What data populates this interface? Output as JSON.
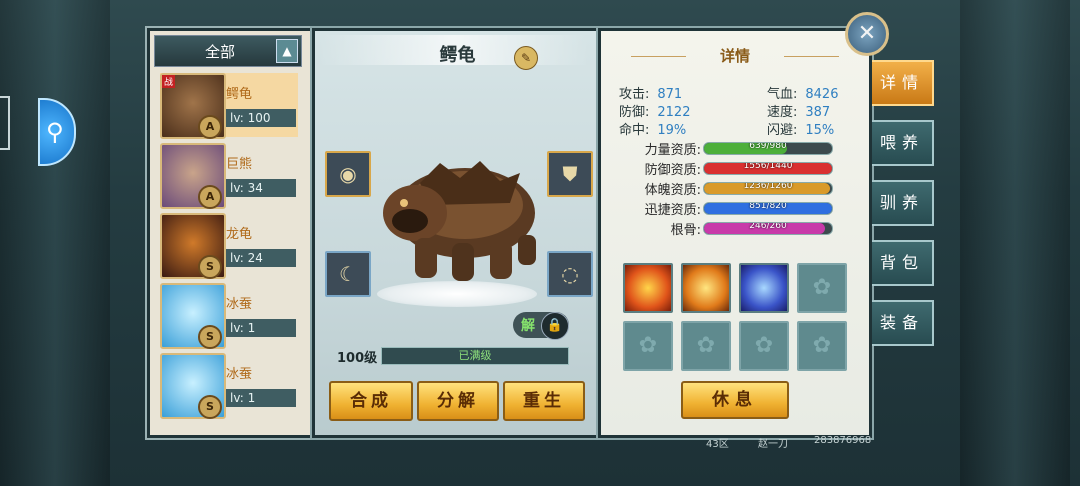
{
  "list": {
    "filter_label": "全部",
    "pets": [
      {
        "name": "鳄龟",
        "level": "lv: 100",
        "grade": "A",
        "color": "#6b4428",
        "selected": true,
        "badge": "战"
      },
      {
        "name": "巨熊",
        "level": "lv: 34",
        "grade": "A",
        "color": "#8a6a5a",
        "selected": false
      },
      {
        "name": "龙龟",
        "level": "lv: 24",
        "grade": "S",
        "color": "#7a3a1a",
        "selected": false
      },
      {
        "name": "冰蚕",
        "level": "lv: 1",
        "grade": "S",
        "color": "#6cc6f0",
        "selected": false
      },
      {
        "name": "冰蚕",
        "level": "lv: 1",
        "grade": "S",
        "color": "#6cc6f0",
        "selected": false
      }
    ]
  },
  "detail": {
    "pet_name": "鳄龟",
    "unlock_label": "解",
    "level_label": "100级",
    "exp_label": "已满级",
    "buttons": {
      "compose": "合成",
      "decompose": "分解",
      "rebirth": "重生"
    }
  },
  "info": {
    "title": "详情",
    "stats": {
      "attack_label": "攻击:",
      "attack": "871",
      "hp_label": "气血:",
      "hp": "8426",
      "defense_label": "防御:",
      "defense": "2122",
      "speed_label": "速度:",
      "speed": "387",
      "hit_label": "命中:",
      "hit": "19%",
      "dodge_label": "闪避:",
      "dodge": "15%"
    },
    "aptitudes": [
      {
        "label": "力量资质:",
        "value": "639/980",
        "ratio": 0.652,
        "color": "#4caf3a"
      },
      {
        "label": "防御资质:",
        "value": "1556/1440",
        "ratio": 1.0,
        "color": "#d93030"
      },
      {
        "label": "体魄资质:",
        "value": "1236/1260",
        "ratio": 0.981,
        "color": "#d99a2a"
      },
      {
        "label": "迅捷资质:",
        "value": "851/820",
        "ratio": 1.0,
        "color": "#2f6fe0"
      },
      {
        "label": "根骨:",
        "value": "246/260",
        "ratio": 0.946,
        "color": "#c83aa9"
      }
    ],
    "skill_icons": [
      "fire-ring-icon",
      "shield-flame-icon",
      "blue-shield-icon"
    ],
    "rest_label": "休息"
  },
  "tabs": [
    "详情",
    "喂养",
    "驯养",
    "背包",
    "装备"
  ],
  "footer": {
    "server": "43区",
    "player": "赵一刀",
    "id": "283876968"
  }
}
